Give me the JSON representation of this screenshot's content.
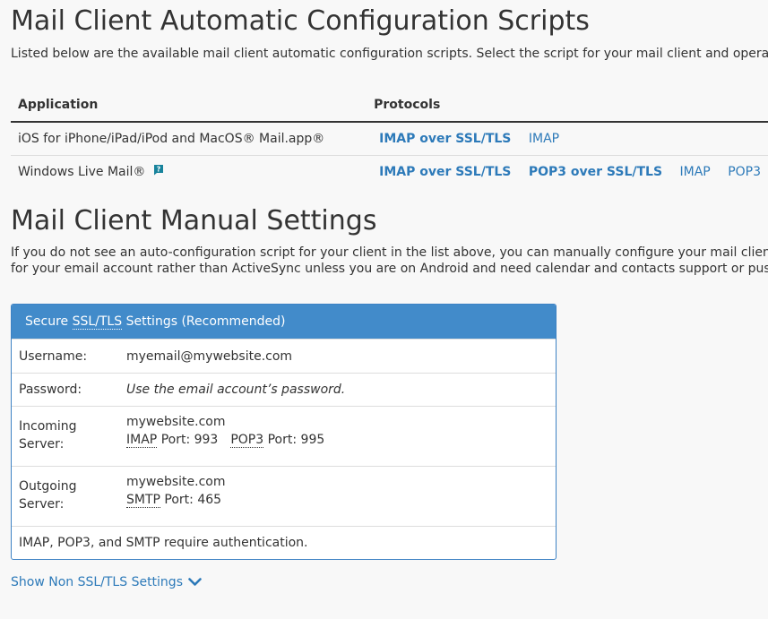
{
  "auto": {
    "title": "Mail Client Automatic Configuration Scripts",
    "intro": "Listed below are the available mail client automatic configuration scripts. Select the script for your mail client and operating system.",
    "table": {
      "headers": [
        "Application",
        "Protocols"
      ],
      "rows": [
        {
          "app": "iOS for iPhone/iPad/iPod and MacOS® Mail.app®",
          "protocols": [
            {
              "label": "IMAP over SSL/TLS",
              "strong": true
            },
            {
              "label": "IMAP",
              "strong": false
            }
          ]
        },
        {
          "app": "Windows Live Mail®",
          "protocols": [
            {
              "label": "IMAP over SSL/TLS",
              "strong": true
            },
            {
              "label": "POP3 over SSL/TLS",
              "strong": true
            },
            {
              "label": "IMAP",
              "strong": false
            },
            {
              "label": "POP3",
              "strong": false
            }
          ]
        }
      ]
    }
  },
  "manual": {
    "title": "Mail Client Manual Settings",
    "intro_line1": "If you do not see an auto-configuration script for your client in the list above, you can manually configure your mail client using the settings below.",
    "intro_line2": "for your email account rather than ActiveSync unless you are on Android and need calendar and contacts support or push updates."
  },
  "panel": {
    "heading_ssl": "SSL/TLS",
    "heading_prefix": "Secure",
    "heading_suffix": "Settings (Recommended)",
    "username_label": "Username:",
    "username_value": "myemail@mywebsite.com",
    "password_label": "Password:",
    "password_value": "Use the email account’s password.",
    "incoming_label_1": "Incoming",
    "incoming_label_2": "Server:",
    "incoming_host": "mywebsite.com",
    "imap_abbr": "IMAP",
    "imap_port": "Port: 993",
    "pop3_abbr": "POP3",
    "pop3_port": "Port: 995",
    "outgoing_label_1": "Outgoing",
    "outgoing_label_2": "Server:",
    "outgoing_host": "mywebsite.com",
    "smtp_abbr": "SMTP",
    "smtp_port": "Port: 465",
    "note": "IMAP, POP3, and SMTP require authentication."
  },
  "toggle": {
    "label": "Show Non SSL/TLS Settings"
  },
  "icons": {
    "help": "help-icon",
    "toggle": "chevron-down-icon"
  },
  "colors": {
    "link": "#2d7ab9",
    "panel_heading": "#428bca",
    "help_icon": "#18839c"
  }
}
